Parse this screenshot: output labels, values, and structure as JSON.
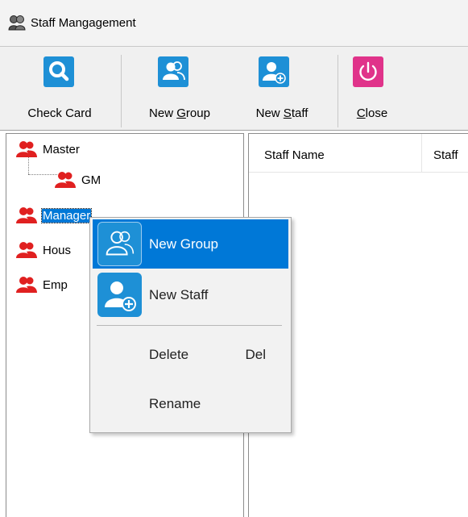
{
  "window": {
    "title": "Staff Mangagement",
    "app_icon": "app-group-icon"
  },
  "toolbar": {
    "buttons": [
      {
        "label": "Check Card",
        "mnemonic": "",
        "icon": "search-icon",
        "color": "#1e90d6"
      },
      {
        "label_pre": "New ",
        "mnemonic": "G",
        "label_post": "roup",
        "icon": "group-icon",
        "color": "#1e90d6"
      },
      {
        "label_pre": "New ",
        "mnemonic": "S",
        "label_post": "taff",
        "icon": "add-staff-icon",
        "color": "#1e90d6"
      },
      {
        "label_pre": "",
        "mnemonic": "C",
        "label_post": "lose",
        "icon": "power-icon",
        "color": "#e0338a"
      }
    ]
  },
  "tree": {
    "nodes": [
      {
        "label": "Master"
      },
      {
        "label": "GM"
      },
      {
        "label": "Manager",
        "selected": true
      },
      {
        "label": "Hous"
      },
      {
        "label": "Emp"
      }
    ],
    "icon_color": "#e02020"
  },
  "list": {
    "columns": [
      "Staff Name",
      "Staff"
    ]
  },
  "context_menu": {
    "items": [
      {
        "label": "New Group",
        "icon": "group-icon",
        "highlighted": true
      },
      {
        "label": "New Staff",
        "icon": "add-staff-icon"
      },
      {
        "label": "Delete",
        "shortcut": "Del"
      },
      {
        "label": "Rename"
      }
    ],
    "highlight_color": "#0078d7"
  }
}
